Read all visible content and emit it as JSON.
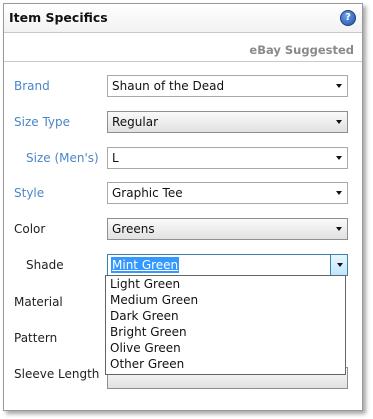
{
  "header": {
    "title": "Item Specifics",
    "help_icon": "?"
  },
  "suggested_label": "eBay Suggested",
  "fields": {
    "brand": {
      "label": "Brand",
      "value": "Shaun of the Dead"
    },
    "size_type": {
      "label": "Size Type",
      "value": "Regular"
    },
    "size_mens": {
      "label": "Size (Men's)",
      "value": "L"
    },
    "style": {
      "label": "Style",
      "value": "Graphic Tee"
    },
    "color": {
      "label": "Color",
      "value": "Greens"
    },
    "shade": {
      "label": "Shade",
      "value": "Mint Green"
    },
    "material": {
      "label": "Material"
    },
    "pattern": {
      "label": "Pattern"
    },
    "sleeve_length": {
      "label": "Sleeve Length"
    }
  },
  "shade_options": [
    "Light Green",
    "Medium Green",
    "Dark Green",
    "Bright Green",
    "Olive Green",
    "Other Green"
  ],
  "colors": {
    "label_blue": "#4a86c8",
    "highlight": "#3399ff"
  }
}
